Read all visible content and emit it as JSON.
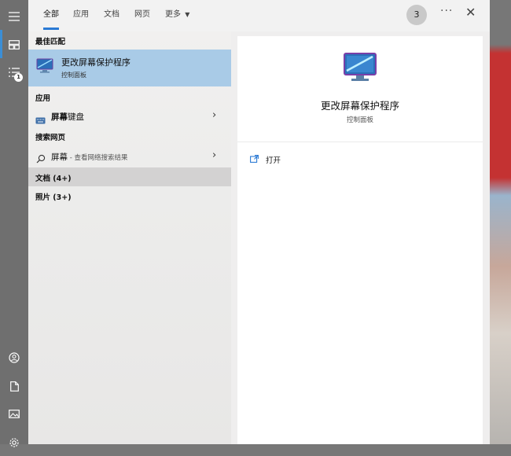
{
  "tabs": [
    {
      "label": "全部"
    },
    {
      "label": "应用"
    },
    {
      "label": "文档"
    },
    {
      "label": "网页"
    },
    {
      "label": "更多"
    }
  ],
  "header": {
    "badge_count": "3",
    "more_options": "···",
    "close": "✕"
  },
  "rail": {
    "notification_count": "1"
  },
  "left": {
    "best_match_header": "最佳匹配",
    "best_match": {
      "title": "更改屏幕保护程序",
      "subtitle": "控制面板"
    },
    "apps_header": "应用",
    "app_item": {
      "label_bold": "屏幕",
      "label_rest": "键盘"
    },
    "web_header": "搜索网页",
    "web_item": {
      "label": "屏幕",
      "suffix": " - 查看网络搜索结果"
    },
    "docs": "文档 (4+)",
    "photos": "照片 (3+)"
  },
  "right": {
    "title": "更改屏幕保护程序",
    "subtitle": "控制面板",
    "action_open": "打开"
  },
  "icons": {
    "hamburger": "hamburger-icon",
    "home": "home-icon",
    "list": "list-icon",
    "user": "user-icon",
    "document": "document-icon",
    "image": "image-icon",
    "settings": "settings-icon",
    "screensaver": "monitor-icon",
    "keyboard": "keyboard-icon",
    "search": "search-icon",
    "open": "open-icon"
  },
  "colors": {
    "accent": "#2b7ad4",
    "selection": "#a9cbe7"
  }
}
